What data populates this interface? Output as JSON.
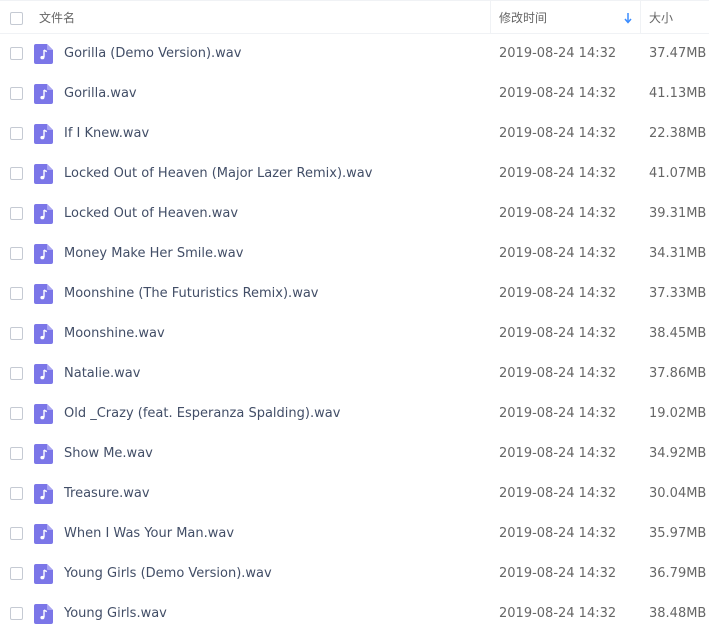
{
  "header": {
    "name_label": "文件名",
    "time_label": "修改时间",
    "size_label": "大小",
    "sort_icon": "arrow-down-icon"
  },
  "colors": {
    "icon_bg": "#7b76e8",
    "icon_glyph": "#ffffff",
    "sort_arrow": "#3b8cff",
    "name_text": "#424e67",
    "meta_text": "#666666"
  },
  "files": [
    {
      "name": "Gorilla (Demo Version).wav",
      "time": "2019-08-24 14:32",
      "size": "37.47MB",
      "icon": "music-file-icon"
    },
    {
      "name": "Gorilla.wav",
      "time": "2019-08-24 14:32",
      "size": "41.13MB",
      "icon": "music-file-icon"
    },
    {
      "name": "If I Knew.wav",
      "time": "2019-08-24 14:32",
      "size": "22.38MB",
      "icon": "music-file-icon"
    },
    {
      "name": "Locked Out of Heaven (Major Lazer Remix).wav",
      "time": "2019-08-24 14:32",
      "size": "41.07MB",
      "icon": "music-file-icon"
    },
    {
      "name": "Locked Out of Heaven.wav",
      "time": "2019-08-24 14:32",
      "size": "39.31MB",
      "icon": "music-file-icon"
    },
    {
      "name": "Money Make Her Smile.wav",
      "time": "2019-08-24 14:32",
      "size": "34.31MB",
      "icon": "music-file-icon"
    },
    {
      "name": "Moonshine (The Futuristics Remix).wav",
      "time": "2019-08-24 14:32",
      "size": "37.33MB",
      "icon": "music-file-icon"
    },
    {
      "name": "Moonshine.wav",
      "time": "2019-08-24 14:32",
      "size": "38.45MB",
      "icon": "music-file-icon"
    },
    {
      "name": "Natalie.wav",
      "time": "2019-08-24 14:32",
      "size": "37.86MB",
      "icon": "music-file-icon"
    },
    {
      "name": "Old _Crazy (feat. Esperanza Spalding).wav",
      "time": "2019-08-24 14:32",
      "size": "19.02MB",
      "icon": "music-file-icon"
    },
    {
      "name": "Show Me.wav",
      "time": "2019-08-24 14:32",
      "size": "34.92MB",
      "icon": "music-file-icon"
    },
    {
      "name": "Treasure.wav",
      "time": "2019-08-24 14:32",
      "size": "30.04MB",
      "icon": "music-file-icon"
    },
    {
      "name": "When I Was Your Man.wav",
      "time": "2019-08-24 14:32",
      "size": "35.97MB",
      "icon": "music-file-icon"
    },
    {
      "name": "Young Girls (Demo Version).wav",
      "time": "2019-08-24 14:32",
      "size": "36.79MB",
      "icon": "music-file-icon"
    },
    {
      "name": "Young Girls.wav",
      "time": "2019-08-24 14:32",
      "size": "38.48MB",
      "icon": "music-file-icon"
    }
  ]
}
